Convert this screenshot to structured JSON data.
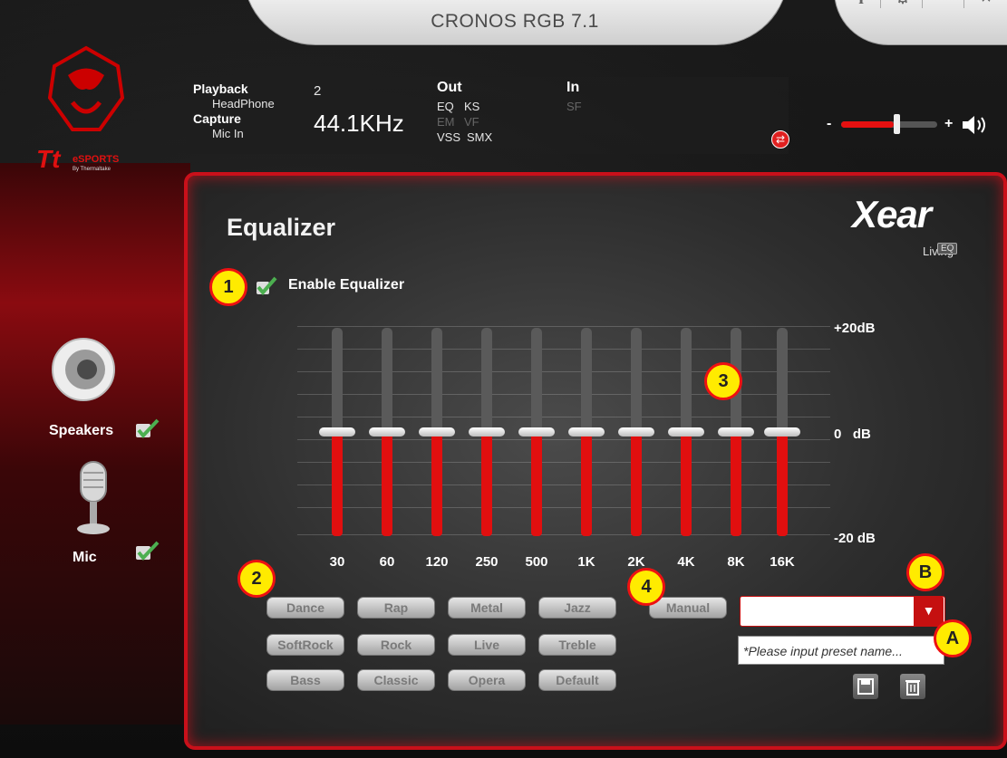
{
  "app": {
    "title": "CRONOS RGB 7.1"
  },
  "window_controls": {
    "info": "i",
    "settings_icon": "gear-icon",
    "minimize": "—",
    "close": "×"
  },
  "brand": {
    "logo_text": "Tt",
    "sub": "eSPORTS",
    "by": "By Thermaltake"
  },
  "info_panel": {
    "playback_label": "Playback",
    "playback_device": "HeadPhone",
    "playback_channels": "2",
    "capture_label": "Capture",
    "capture_device": "Mic In",
    "sample_rate": "44.1KHz",
    "out_label": "Out",
    "out_row1": [
      "EQ",
      "KS"
    ],
    "out_row2": [
      "EM",
      "VF"
    ],
    "out_row3": [
      "VSS",
      "SMX"
    ],
    "in_label": "In",
    "in_row1": "SF"
  },
  "volume": {
    "minus": "-",
    "plus": "+",
    "level": 0.55,
    "icon": "speaker-icon"
  },
  "sidebar": {
    "items": [
      {
        "label": "Speakers",
        "checked": true
      },
      {
        "label": "Mic",
        "checked": true
      }
    ]
  },
  "equalizer": {
    "title": "Equalizer",
    "enable_label": "Enable Equalizer",
    "enabled": true,
    "xear_text": "Xear",
    "living_text": "Living",
    "eq_badge": "EQ",
    "db_labels": {
      "top": "+20dB",
      "mid": "0   dB",
      "bottom": "-20 dB"
    },
    "bands": [
      {
        "freq": "30",
        "gain_db": 0
      },
      {
        "freq": "60",
        "gain_db": 0
      },
      {
        "freq": "120",
        "gain_db": 0
      },
      {
        "freq": "250",
        "gain_db": 0
      },
      {
        "freq": "500",
        "gain_db": 0
      },
      {
        "freq": "1K",
        "gain_db": 0
      },
      {
        "freq": "2K",
        "gain_db": 0
      },
      {
        "freq": "4K",
        "gain_db": 0
      },
      {
        "freq": "8K",
        "gain_db": 0
      },
      {
        "freq": "16K",
        "gain_db": 0
      }
    ],
    "presets": [
      "Dance",
      "Rap",
      "Metal",
      "Jazz",
      "SoftRock",
      "Rock",
      "Live",
      "Treble",
      "Bass",
      "Classic",
      "Opera",
      "Default"
    ],
    "manual_label": "Manual",
    "preset_select_value": "",
    "preset_name_placeholder": "*Please input preset name..."
  },
  "annotations": [
    "1",
    "2",
    "3",
    "4",
    "A",
    "B"
  ],
  "colors": {
    "accent": "#e10f0f",
    "marker": "#ffeb00"
  }
}
